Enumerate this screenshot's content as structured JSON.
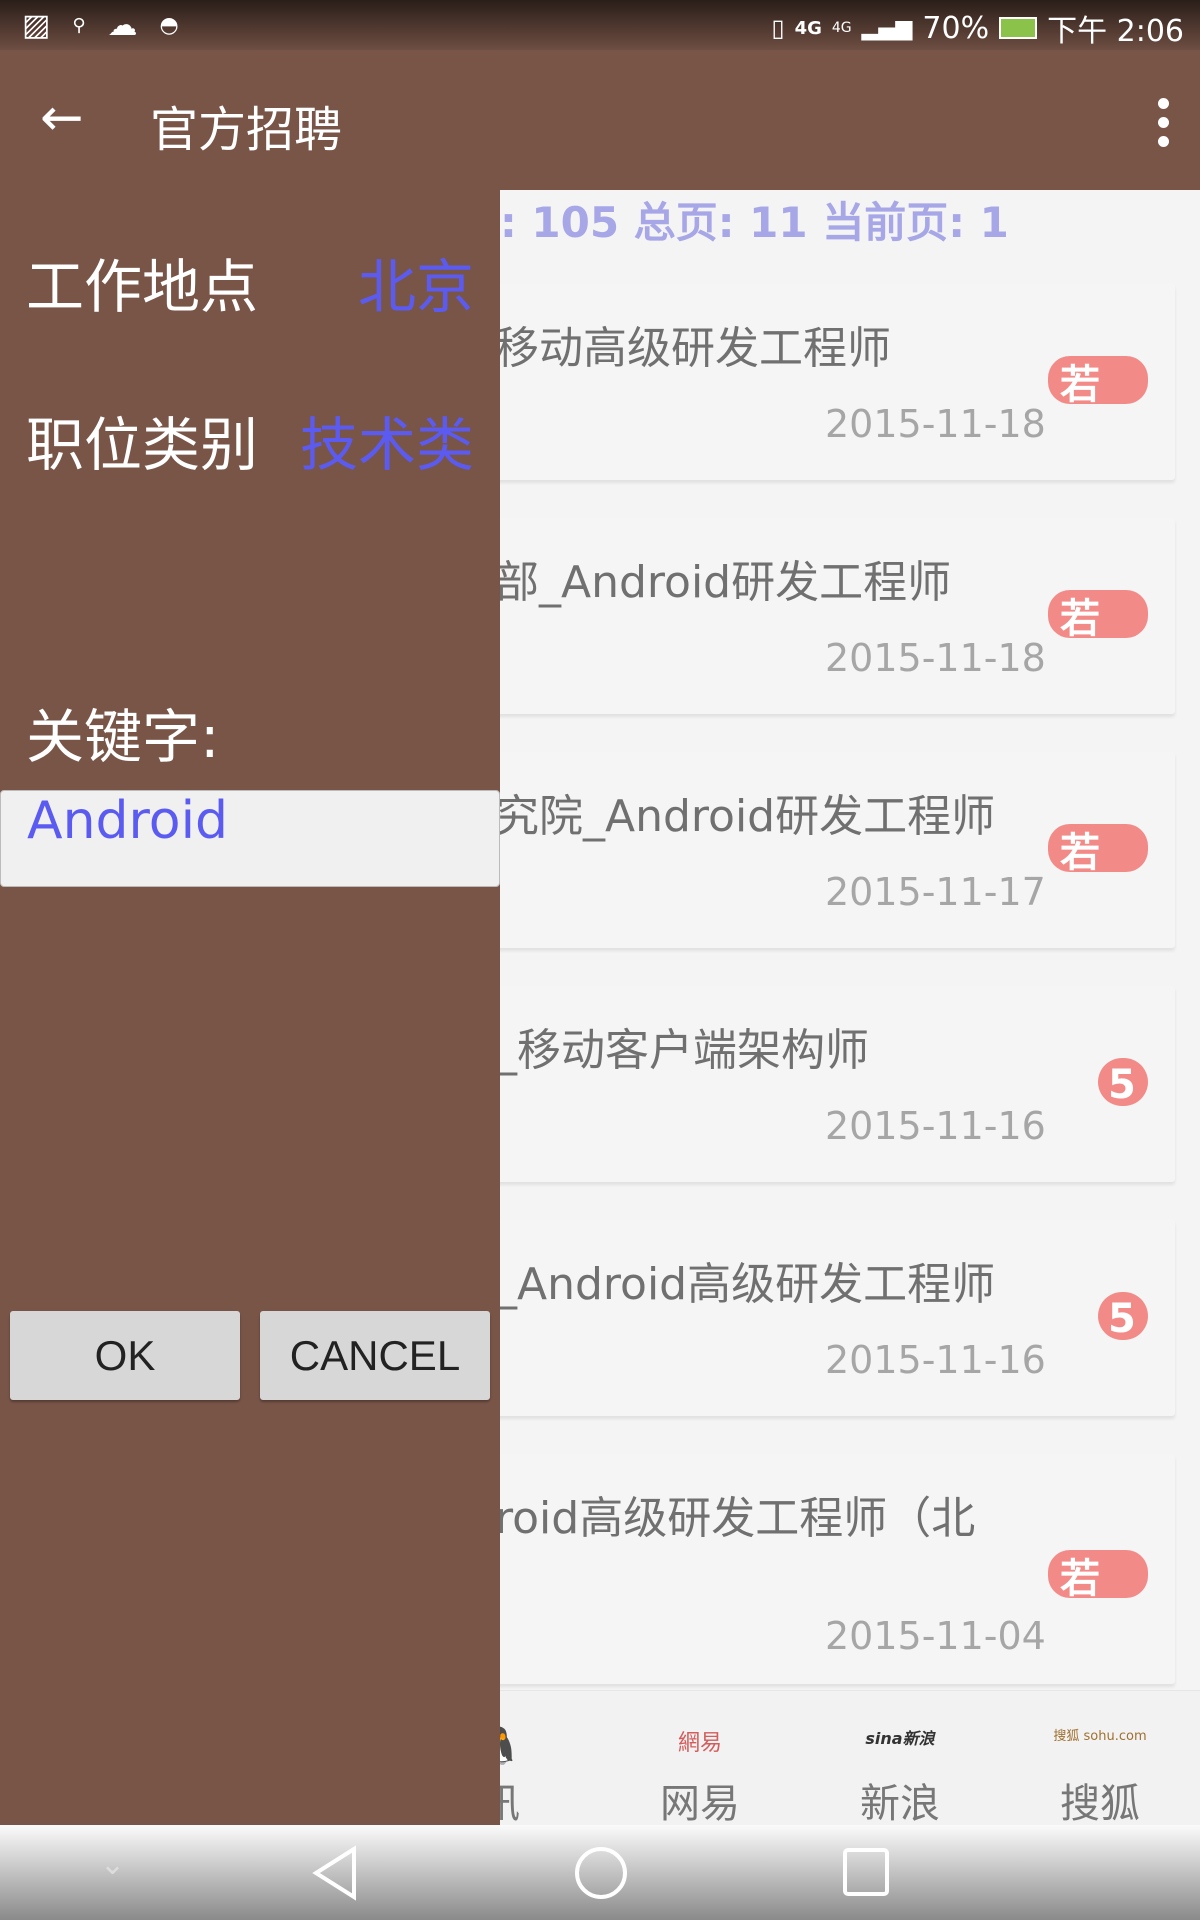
{
  "status_bar": {
    "network": "4G",
    "network2": "4G",
    "battery": "70%",
    "time": "下午 2:06",
    "icons": [
      "image-icon",
      "search-icon",
      "cloud-icon",
      "android-icon",
      "vibrate-icon",
      "signal-icon",
      "battery-icon"
    ]
  },
  "toolbar": {
    "title": "官方招聘",
    "back_icon": "arrow-left-icon",
    "menu_icon": "more-vert-icon"
  },
  "list": {
    "header": ": 105  总页: 11  当前页: 1",
    "items": [
      {
        "title": "移动高级研发工程师",
        "date": "2015-11-18",
        "badge": "若",
        "badge_shape": "pill"
      },
      {
        "title": "部_Android研发工程师",
        "date": "2015-11-18",
        "badge": "若",
        "badge_shape": "pill"
      },
      {
        "title": "究院_Android研发工程师",
        "date": "2015-11-17",
        "badge": "若",
        "badge_shape": "pill"
      },
      {
        "title": "_移动客户端架构师",
        "date": "2015-11-16",
        "badge": "5",
        "badge_shape": "round"
      },
      {
        "title": "_Android高级研发工程师",
        "date": "2015-11-16",
        "badge": "5",
        "badge_shape": "round"
      },
      {
        "title": "roid高级研发工程师（北",
        "date": "2015-11-04",
        "badge": "若",
        "badge_shape": "pill"
      }
    ],
    "badge_color": "#f28b88"
  },
  "tabs": [
    {
      "label": "讯",
      "logo": "qq-penguin-icon"
    },
    {
      "label": "网易",
      "logo_text": "網易"
    },
    {
      "label": "新浪",
      "logo_text": "sina新浪"
    },
    {
      "label": "搜狐",
      "logo_text": "搜狐 sohu.com"
    }
  ],
  "drawer": {
    "location_label": "工作地点",
    "location_value": "北京",
    "category_label": "职位类别",
    "category_value": "技术类",
    "keyword_label": "关键字:",
    "keyword_value": "Android",
    "ok": "OK",
    "cancel": "CANCEL",
    "bg_color": "#795548",
    "accent": "#5b5bf2"
  }
}
